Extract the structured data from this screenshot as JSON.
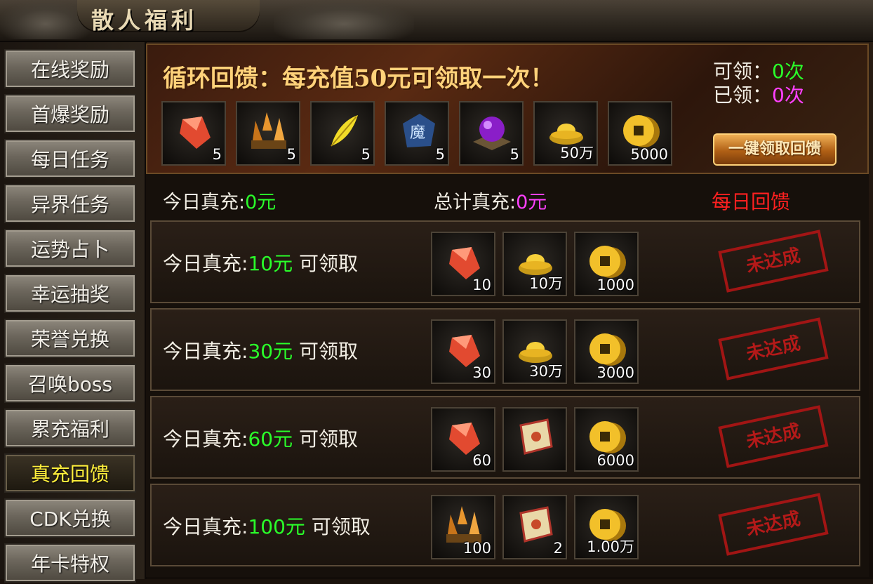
{
  "window": {
    "title": "散人福利"
  },
  "sidebar": {
    "items": [
      {
        "label": "在线奖励"
      },
      {
        "label": "首爆奖励"
      },
      {
        "label": "每日任务"
      },
      {
        "label": "异界任务"
      },
      {
        "label": "运势占卜"
      },
      {
        "label": "幸运抽奖"
      },
      {
        "label": "荣誉兑换"
      },
      {
        "label": "召唤boss"
      },
      {
        "label": "累充福利"
      },
      {
        "label": "真充回馈",
        "active": true
      },
      {
        "label": "CDK兑换"
      },
      {
        "label": "年卡特权"
      }
    ]
  },
  "banner": {
    "title": "循环回馈：每充值50元可领取一次！",
    "claimable_label": "可领：",
    "claimable_value": "0次",
    "claimed_label": "已领：",
    "claimed_value": "0次",
    "claim_button": "一键领取回馈",
    "rewards": [
      {
        "icon": "red-crystal-icon",
        "qty": "5"
      },
      {
        "icon": "orange-crystal-cluster-icon",
        "qty": "5"
      },
      {
        "icon": "gold-feather-icon",
        "qty": "5"
      },
      {
        "icon": "demon-stone-icon",
        "qty": "5"
      },
      {
        "icon": "purple-orb-icon",
        "qty": "5"
      },
      {
        "icon": "gold-ingot-icon",
        "qty": "50万"
      },
      {
        "icon": "gold-coin-icon",
        "qty": "5000"
      }
    ]
  },
  "summary": {
    "today_label": "今日真充:",
    "today_value": "0元",
    "total_label": "总计真充:",
    "total_value": "0元",
    "daily_label": "每日回馈"
  },
  "tiers": [
    {
      "label": "今日真充:",
      "amount": "10元",
      "suffix": " 可领取",
      "status": "未达成",
      "rewards": [
        {
          "icon": "red-crystal-icon",
          "qty": "10"
        },
        {
          "icon": "gold-ingot-icon",
          "qty": "10万"
        },
        {
          "icon": "gold-coin-icon",
          "qty": "1000"
        }
      ]
    },
    {
      "label": "今日真充:",
      "amount": "30元",
      "suffix": " 可领取",
      "status": "未达成",
      "rewards": [
        {
          "icon": "red-crystal-icon",
          "qty": "30"
        },
        {
          "icon": "gold-ingot-icon",
          "qty": "30万"
        },
        {
          "icon": "gold-coin-icon",
          "qty": "3000"
        }
      ]
    },
    {
      "label": "今日真充:",
      "amount": "60元",
      "suffix": " 可领取",
      "status": "未达成",
      "rewards": [
        {
          "icon": "red-crystal-icon",
          "qty": "60"
        },
        {
          "icon": "scroll-icon",
          "qty": ""
        },
        {
          "icon": "gold-coin-icon",
          "qty": "6000"
        }
      ]
    },
    {
      "label": "今日真充:",
      "amount": "100元",
      "suffix": " 可领取",
      "status": "未达成",
      "rewards": [
        {
          "icon": "orange-crystal-cluster-icon",
          "qty": "100"
        },
        {
          "icon": "scroll-icon",
          "qty": "2"
        },
        {
          "icon": "gold-coin-icon",
          "qty": "1.00万"
        }
      ]
    }
  ],
  "colors": {
    "green_value": "#2aff2a",
    "pink_value": "#ff40ff",
    "red_text": "#ff2020",
    "active_menu_text": "#ffef3c"
  }
}
